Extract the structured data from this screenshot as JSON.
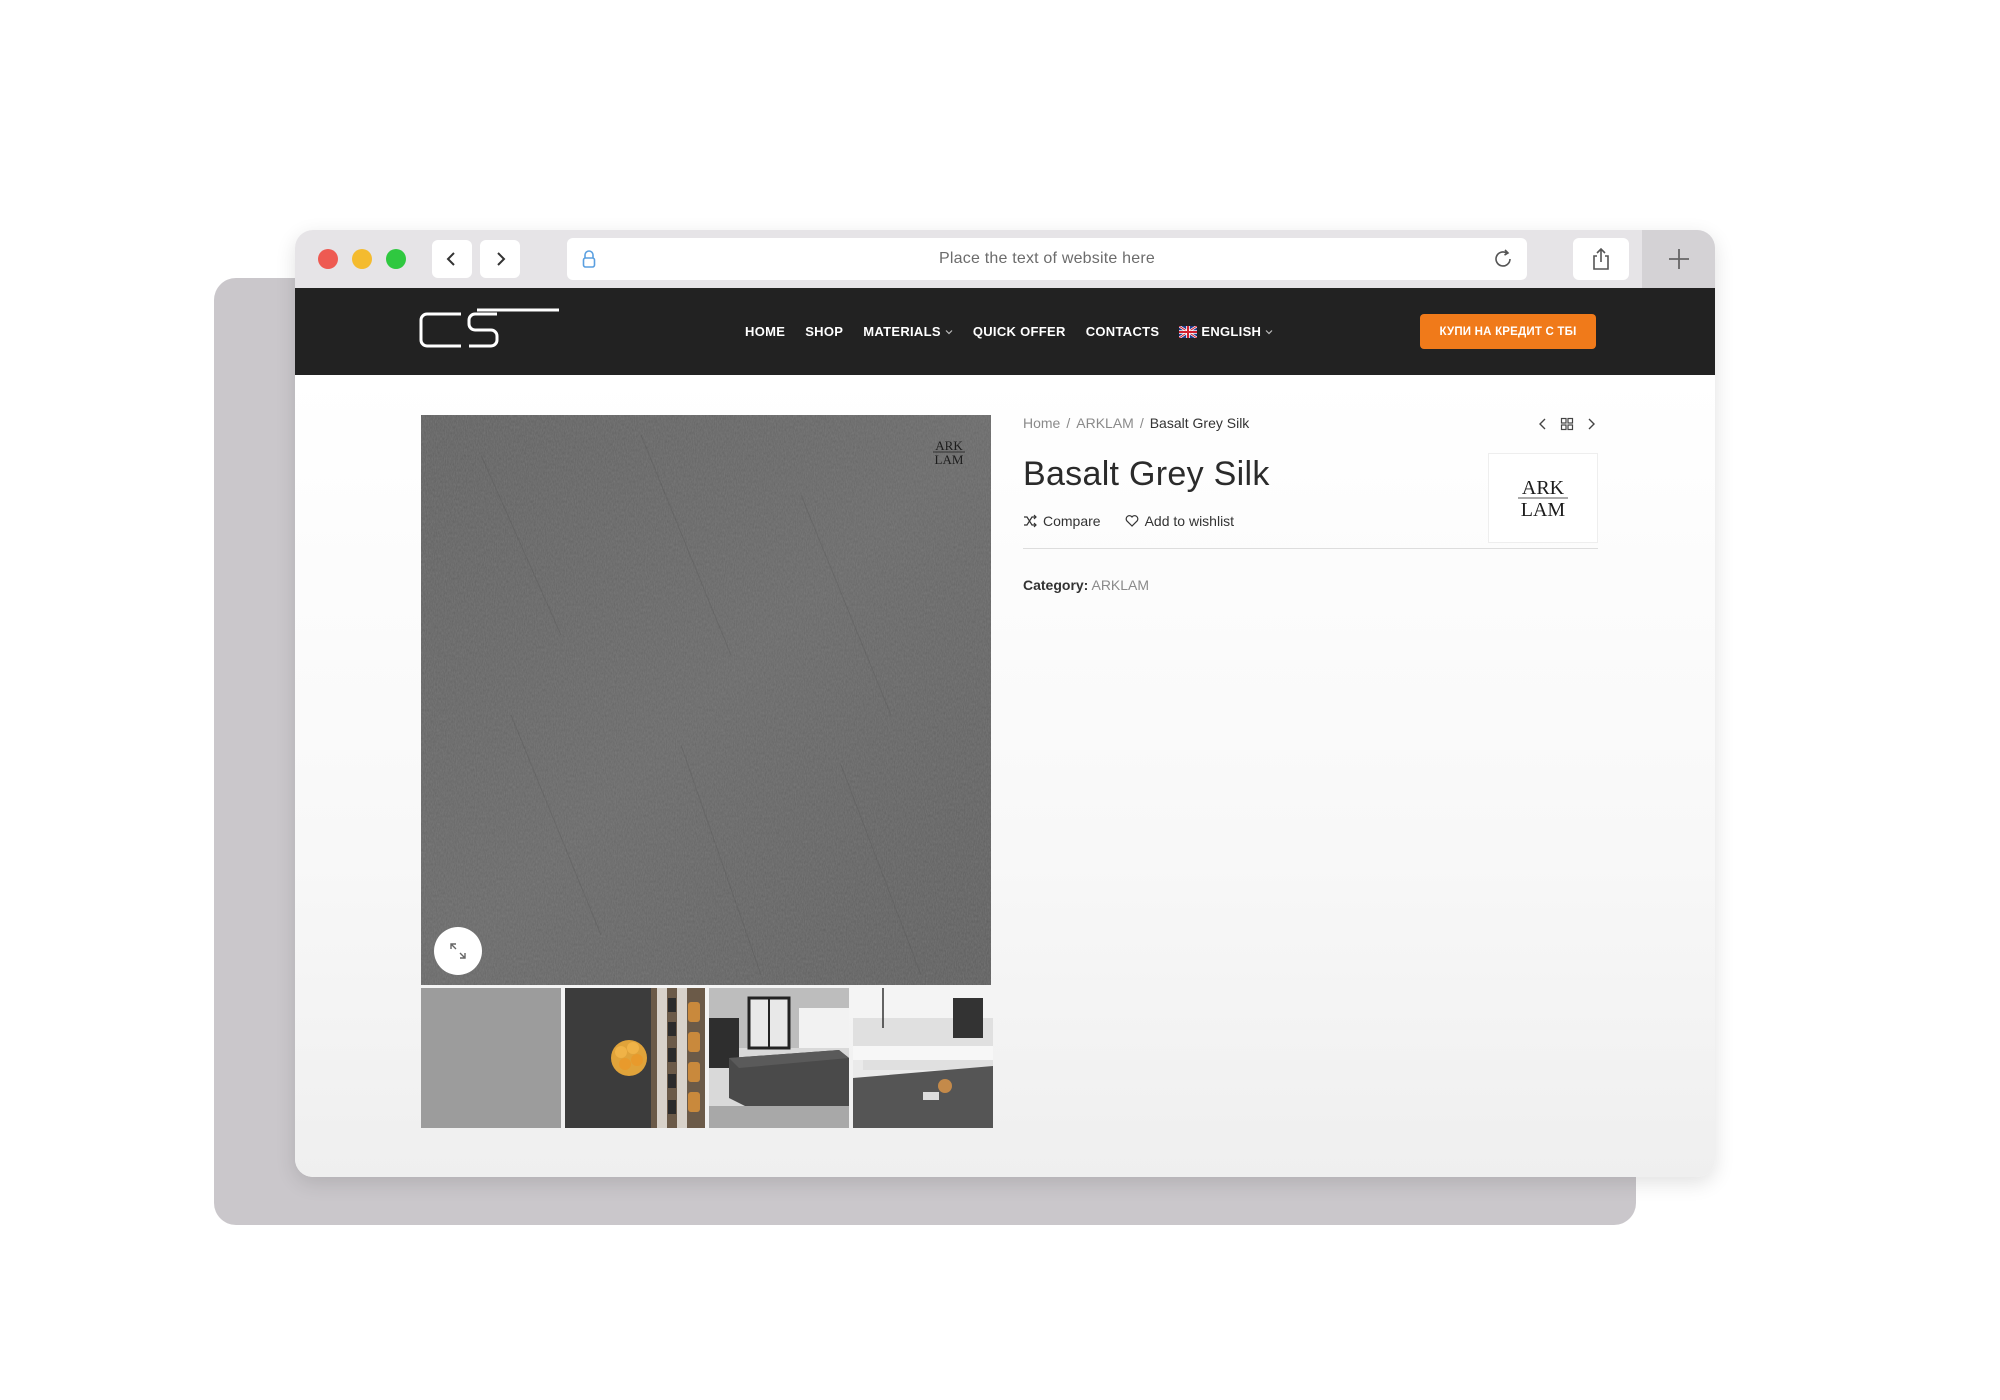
{
  "browser": {
    "url_text": "Place the text of website here"
  },
  "site": {
    "logo_text": "CS",
    "nav": [
      {
        "label": "HOME",
        "has_dropdown": false
      },
      {
        "label": "SHOP",
        "has_dropdown": false
      },
      {
        "label": "MATERIALS",
        "has_dropdown": true
      },
      {
        "label": "QUICK OFFER",
        "has_dropdown": false
      },
      {
        "label": "CONTACTS",
        "has_dropdown": false
      },
      {
        "label": "ENGLISH",
        "has_dropdown": true,
        "icon": "uk-flag-icon"
      }
    ],
    "cta_label": "КУПИ НА КРЕДИТ С ТБІ",
    "colors": {
      "header_bg": "#222222",
      "cta": "#f07a1a"
    }
  },
  "product": {
    "breadcrumb": [
      {
        "label": "Home"
      },
      {
        "label": "ARKLAM"
      },
      {
        "label": "Basalt Grey Silk"
      }
    ],
    "title": "Basalt Grey Silk",
    "compare_label": "Compare",
    "wishlist_label": "Add to wishlist",
    "category_label": "Category:",
    "category_value": "ARKLAM",
    "brand_logo": {
      "line1": "ARK",
      "line2": "LAM"
    },
    "thumbnails": [
      "grey-slab-thumb",
      "drawer-oranges-thumb",
      "kitchen-island-thumb",
      "kitchen-counter-thumb"
    ]
  }
}
